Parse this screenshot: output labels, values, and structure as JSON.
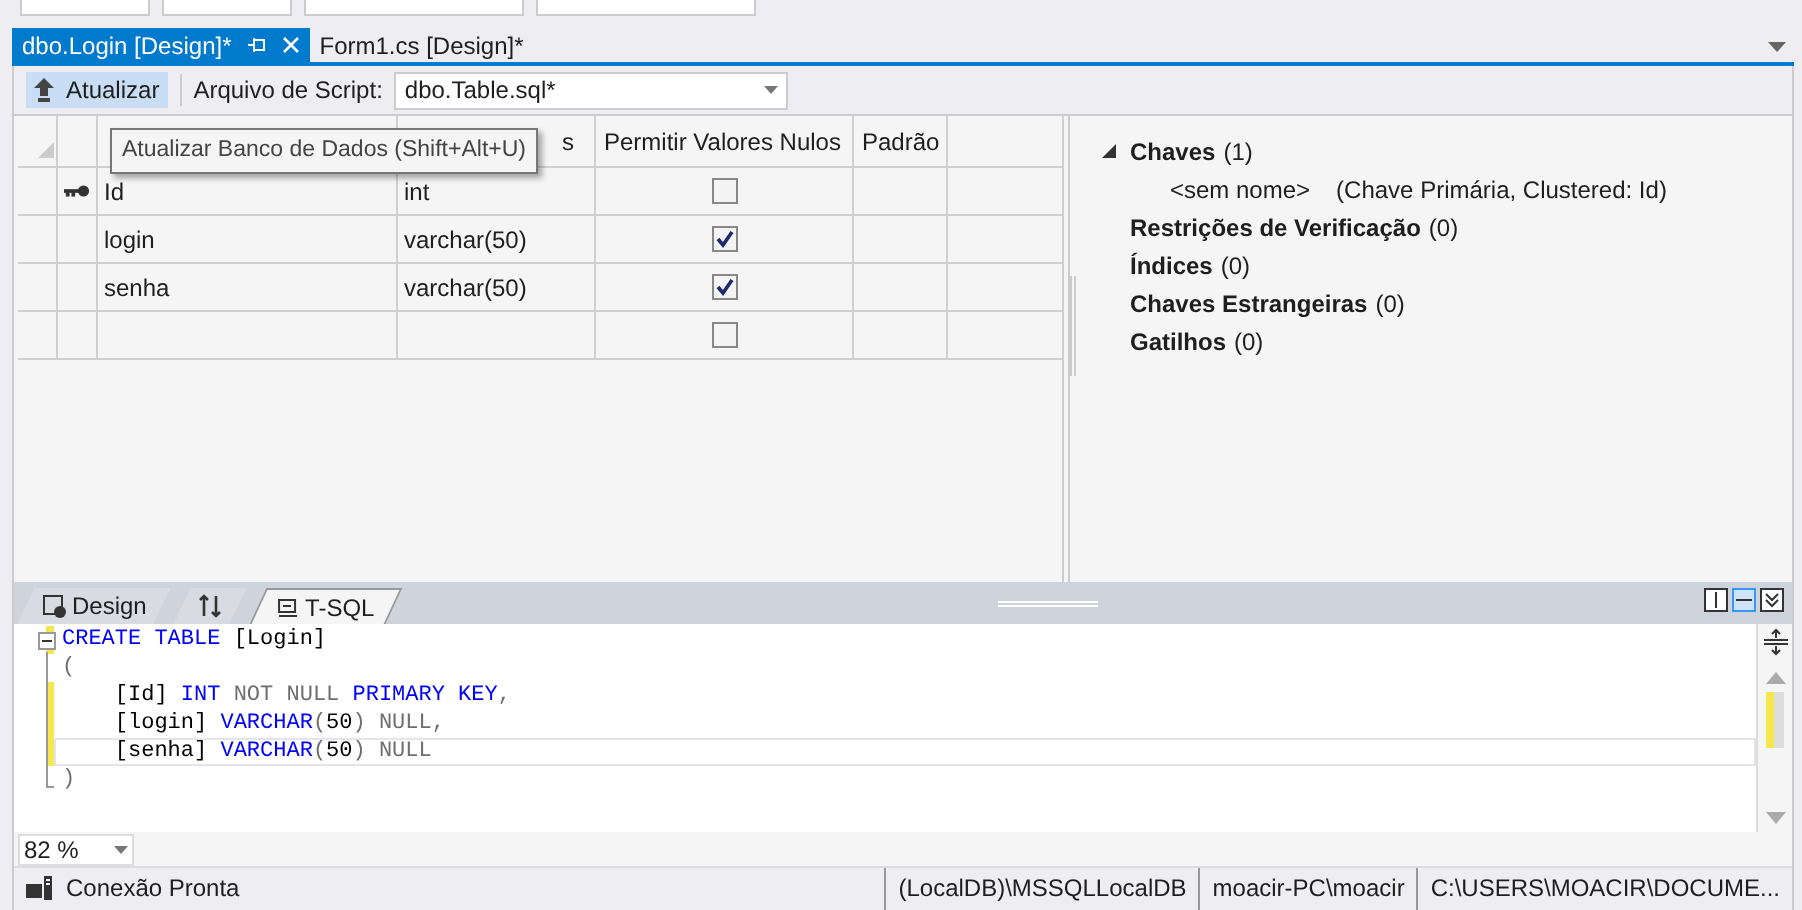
{
  "tabs": [
    {
      "label": "dbo.Login [Design]*",
      "selected": true,
      "pinned": true
    },
    {
      "label": "Form1.cs [Design]*",
      "selected": false,
      "pinned": false
    }
  ],
  "toolbar": {
    "update_button": "Atualizar",
    "script_label": "Arquivo de Script:",
    "script_file": "dbo.Table.sql*"
  },
  "tooltip": "Atualizar Banco de Dados (Shift+Alt+U)",
  "grid": {
    "header_cells": [
      "s",
      "Permitir Valores Nulos",
      "Padrão"
    ],
    "rows": [
      {
        "primary_key": true,
        "name": "Id",
        "type": "int",
        "allow_nulls": false
      },
      {
        "primary_key": false,
        "name": "login",
        "type": "varchar(50)",
        "allow_nulls": true
      },
      {
        "primary_key": false,
        "name": "senha",
        "type": "varchar(50)",
        "allow_nulls": true
      },
      {
        "primary_key": false,
        "allow_nulls": false
      }
    ]
  },
  "properties": [
    {
      "label": "Chaves",
      "count": "(1)",
      "expanded": true,
      "children": [
        {
          "name": "<sem nome>",
          "detail": "(Chave Primária, Clustered: Id)"
        }
      ]
    },
    {
      "label": "Restrições de Verificação",
      "count": "(0)"
    },
    {
      "label": "Índices",
      "count": "(0)"
    },
    {
      "label": "Chaves Estrangeiras",
      "count": "(0)"
    },
    {
      "label": "Gatilhos",
      "count": "(0)"
    }
  ],
  "pane_tabs": [
    {
      "kind": "design",
      "label": "Design",
      "selected": false
    },
    {
      "kind": "swap",
      "selected": false
    },
    {
      "kind": "tsql",
      "label": "T-SQL",
      "selected": true
    }
  ],
  "sql_lines": [
    {
      "changed": true,
      "current": false,
      "tokens": [
        {
          "kind": "keyword",
          "t": "CREATE TABLE"
        },
        {
          "kind": "plain",
          "t": " [Login]"
        }
      ]
    },
    {
      "changed": false,
      "current": false,
      "tokens": [
        {
          "kind": "operator",
          "t": "("
        }
      ]
    },
    {
      "changed": true,
      "current": false,
      "tokens": [
        {
          "kind": "plain",
          "t": "    [Id] "
        },
        {
          "kind": "keyword",
          "t": "INT"
        },
        {
          "kind": "operator",
          "t": " NOT NULL "
        },
        {
          "kind": "keyword",
          "t": "PRIMARY KEY"
        },
        {
          "kind": "operator",
          "t": ","
        }
      ]
    },
    {
      "changed": true,
      "current": false,
      "tokens": [
        {
          "kind": "plain",
          "t": "    [login] "
        },
        {
          "kind": "keyword",
          "t": "VARCHAR"
        },
        {
          "kind": "operator",
          "t": "("
        },
        {
          "kind": "plain",
          "t": "50"
        },
        {
          "kind": "operator",
          "t": ") NULL,"
        }
      ]
    },
    {
      "changed": true,
      "current": true,
      "tokens": [
        {
          "kind": "plain",
          "t": "    [senha] "
        },
        {
          "kind": "keyword",
          "t": "VARCHAR"
        },
        {
          "kind": "operator",
          "t": "("
        },
        {
          "kind": "plain",
          "t": "50"
        },
        {
          "kind": "operator",
          "t": ") NULL"
        }
      ]
    },
    {
      "changed": false,
      "current": false,
      "tokens": [
        {
          "kind": "operator",
          "t": ")"
        }
      ]
    }
  ],
  "zoom": "82 %",
  "status_bar": {
    "message": "Conexão Pronta",
    "server": "(LocalDB)\\MSSQLLocalDB",
    "user": "moacir-PC\\moacir",
    "path": "C:\\USERS\\MOACIR\\DOCUME..."
  }
}
